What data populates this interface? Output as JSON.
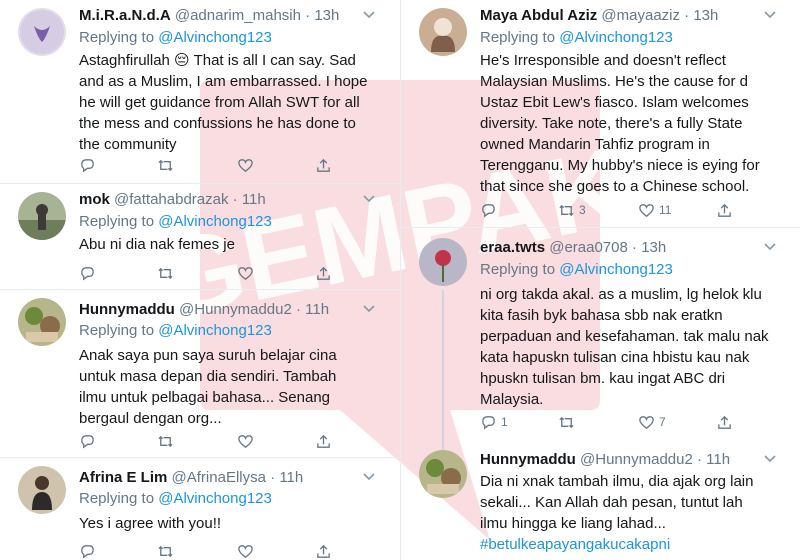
{
  "watermark": {
    "text": "GEMPAK",
    "color": "#f7c6cc"
  },
  "left": [
    {
      "name": "M.i.R.a.N.d.A",
      "handle": "@adnarim_mahsih",
      "time": "13h",
      "reply_prefix": "Replying to",
      "reply_to": "@Alvinchong123",
      "lines": [
        "Astaghfirullah 😔 That is all I can say. Sad",
        "and as a Muslim, I am embarrassed. I hope",
        "he will get guidance from Allah SWT for all",
        "the mess and confussions he has done to",
        "the community"
      ],
      "stats": {
        "reply": "",
        "retweet": "",
        "like": ""
      },
      "avatar_color": "#d9d3e6"
    },
    {
      "name": "mok",
      "handle": "@fattahabdrazak",
      "time": "11h",
      "reply_prefix": "Replying to",
      "reply_to": "@Alvinchong123",
      "lines": [
        "Abu ni dia nak femes je"
      ],
      "stats": {
        "reply": "",
        "retweet": "",
        "like": ""
      },
      "avatar_color": "#8d9a7b"
    },
    {
      "name": "Hunnymaddu",
      "handle": "@Hunnymaddu2",
      "time": "11h",
      "reply_prefix": "Replying to",
      "reply_to": "@Alvinchong123",
      "lines": [
        "Anak saya pun saya suruh belajar cina",
        "untuk masa depan dia sendiri. Tambah",
        "ilmu untuk pelbagai bahasa... Senang",
        "bergaul dengan org..."
      ],
      "stats": {
        "reply": "",
        "retweet": "",
        "like": ""
      },
      "avatar_color": "#9aa46a"
    },
    {
      "name": "Afrina E Lim",
      "handle": "@AfrinaEllysa",
      "time": "11h",
      "reply_prefix": "Replying to",
      "reply_to": "@Alvinchong123",
      "lines": [
        "Yes i agree with you!!"
      ],
      "stats": {
        "reply": "",
        "retweet": "",
        "like": ""
      },
      "avatar_color": "#c8b59a"
    }
  ],
  "right": [
    {
      "name": "Maya Abdul Aziz",
      "handle": "@mayaaziz",
      "time": "13h",
      "reply_prefix": "Replying to",
      "reply_to": "@Alvinchong123",
      "lines": [
        "He's Irresponsible and doesn't reflect",
        "Malaysian Muslims. He's the cause for d",
        "Ustaz Ebit Lew's fiasco. Islam welcomes",
        "diversity. Take note, there's a fully State",
        "owned Mandarin Tahfiz program in",
        "Terengganu. My hubby's niece is eying for",
        "that since she goes to a Chinese school."
      ],
      "stats": {
        "reply": "",
        "retweet": "3",
        "like": "11"
      },
      "avatar_color": "#b89c86"
    },
    {
      "name": "eraa.twts",
      "handle": "@eraa0708",
      "time": "13h",
      "reply_prefix": "Replying to",
      "reply_to": "@Alvinchong123",
      "lines": [
        "ni org takda akal. as a muslim, lg helok klu",
        "kita  fasih byk bahasa sbb nak eratkn",
        "perpaduan and kesefahaman. tak malu nak",
        "kata hapuskn tulisan cina hbistu  kau nak",
        "hpuskn tulisan bm. kau ingat ABC dri",
        "Malaysia."
      ],
      "stats": {
        "reply": "1",
        "retweet": "",
        "like": "7"
      },
      "avatar_color": "#a6a3b8"
    },
    {
      "name": "Hunnymaddu",
      "handle": "@Hunnymaddu2",
      "time": "11h",
      "lines": [
        "Dia ni xnak tambah ilmu, dia ajak org lain",
        "sekali... Kan Allah dah pesan, tuntut lah",
        "ilmu hingga ke liang lahad..."
      ],
      "hashtag": "#betulkeapayangakucakapni",
      "avatar_color": "#9aa46a"
    }
  ]
}
